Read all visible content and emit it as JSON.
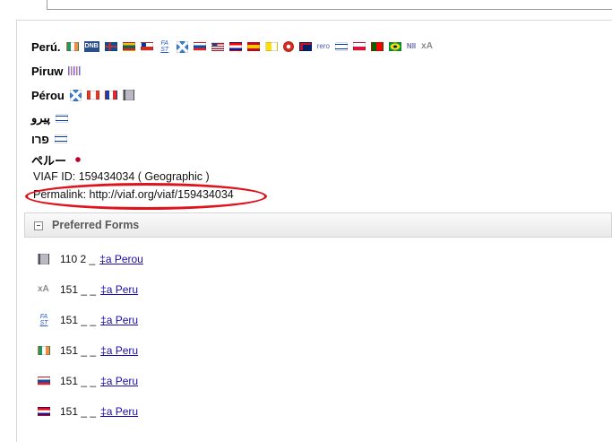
{
  "names": [
    {
      "text": "Perú.",
      "flags": [
        "ireland",
        "dnb",
        "iceland",
        "lithuania",
        "chile",
        "fast",
        "xlink",
        "slovakia",
        "usa",
        "croatia",
        "spain",
        "vatican",
        "switzerland",
        "australia",
        "rero",
        "israel",
        "poland",
        "portugal",
        "brazil",
        "nii",
        "xa"
      ]
    },
    {
      "text": "Piruw",
      "flags": [
        "barcode"
      ]
    },
    {
      "text": "Pérou",
      "flags": [
        "xlink",
        "canada",
        "france",
        "book"
      ]
    },
    {
      "text": "پيرو",
      "flags": [
        "israel"
      ]
    },
    {
      "text": "פרו",
      "flags": [
        "israel"
      ]
    },
    {
      "text": "ペルー",
      "flags": [
        "japan"
      ]
    }
  ],
  "flag_labels": {
    "dnb": "DNB",
    "fast_top": "FA",
    "fast_bottom": "ST",
    "rero": "rero",
    "nii": "NII",
    "xa": "xA"
  },
  "record": {
    "viaf_id": "VIAF ID: 159434034 ( Geographic )",
    "permalink": "Permalink: http://viaf.org/viaf/159434034"
  },
  "preferred_forms": {
    "title": "Preferred Forms",
    "rows": [
      {
        "icon": "book",
        "code": "110 2 _",
        "link": "‡a  Perou"
      },
      {
        "icon": "xa",
        "code": "151 _ _",
        "link": "‡a  Peru"
      },
      {
        "icon": "fast",
        "code": "151 _ _",
        "link": "‡a  Peru"
      },
      {
        "icon": "ireland",
        "code": "151 _ _",
        "link": "‡a  Peru"
      },
      {
        "icon": "slovakia",
        "code": "151 _ _",
        "link": "‡a  Peru"
      },
      {
        "icon": "croatia",
        "code": "151 _ _",
        "link": "‡a  Peru"
      }
    ]
  },
  "colors": {
    "highlight_ellipse": "#e0121b",
    "link": "#1a0dab"
  }
}
